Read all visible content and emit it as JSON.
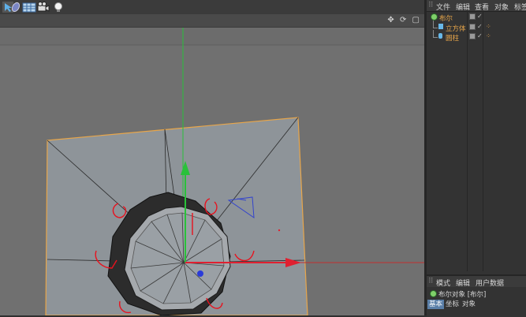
{
  "toolbar": {
    "icons": [
      "cursor-icon",
      "deformer-icon",
      "grid-icon",
      "camera-icon",
      "light-icon"
    ]
  },
  "viewport": {
    "header_icons": "✥ ⟳ ▢"
  },
  "objects_panel": {
    "menu": [
      "文件",
      "编辑",
      "查看",
      "对象",
      "标签"
    ],
    "items": [
      {
        "label": "布尔",
        "color": "#e8a64a"
      },
      {
        "label": "立方体",
        "color": "#e8a64a"
      },
      {
        "label": "圆柱",
        "color": "#e8a64a"
      }
    ]
  },
  "attributes_panel": {
    "menu": [
      "模式",
      "编辑",
      "用户数据"
    ],
    "title": "布尔对象 [布尔]",
    "tabs": [
      "基本",
      "坐标",
      "对象"
    ]
  },
  "colors": {
    "accent": "#e8a64a",
    "axis_y": "#29c13a",
    "axis_x": "#e02030",
    "axis_z": "#2a3bd9"
  }
}
